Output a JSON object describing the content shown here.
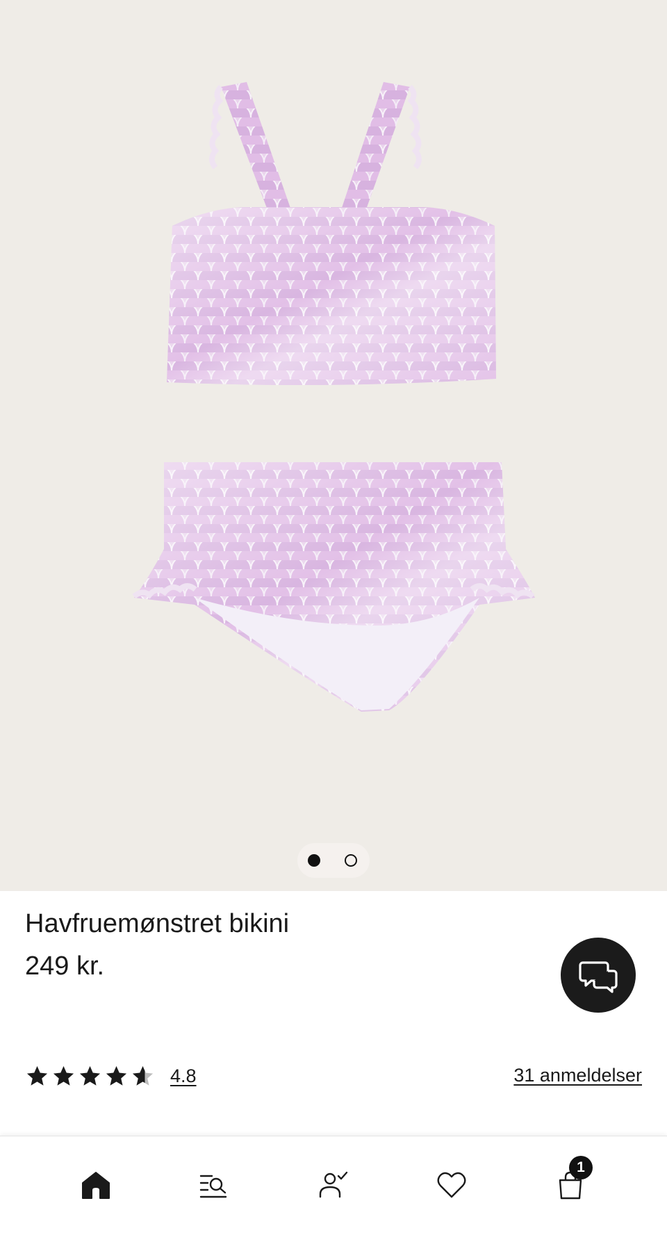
{
  "product": {
    "title": "Havfruemønstret bikini",
    "price": "249 kr.",
    "image_icon": "bikini-product-image"
  },
  "gallery": {
    "slide_count": 2,
    "active_index": 0
  },
  "rating": {
    "value": "4.8",
    "stars": 4.8,
    "max_stars": 5,
    "reviews_link": "31 anmeldelser"
  },
  "chat": {
    "icon": "chat-bubbles-icon"
  },
  "bottom_nav": {
    "items": [
      {
        "icon": "home-icon"
      },
      {
        "icon": "search-list-icon"
      },
      {
        "icon": "account-check-icon"
      },
      {
        "icon": "heart-icon"
      },
      {
        "icon": "shopping-bag-icon"
      }
    ],
    "cart_count": "1"
  },
  "colors": {
    "gallery_background": "#efece7",
    "text": "#1a1a1a",
    "chat_button": "#1b1b1b",
    "badge": "#111111"
  }
}
